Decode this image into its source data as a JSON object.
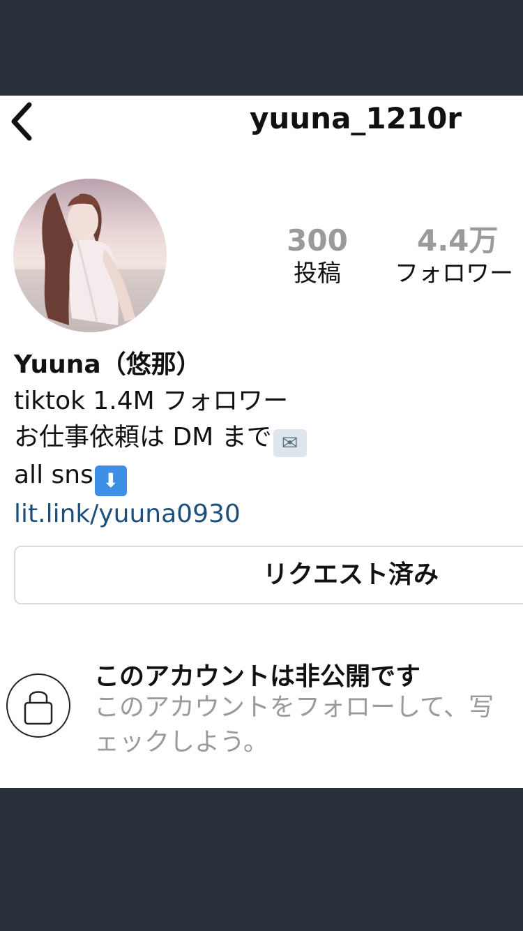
{
  "header": {
    "username": "yuuna_1210r"
  },
  "stats": {
    "posts_value": "300",
    "posts_label": "投稿",
    "followers_value": "4.4万",
    "followers_label": "フォロワー"
  },
  "bio": {
    "name": "Yuuna（悠那）",
    "line1": "tiktok 1.4M フォロワー",
    "line2": "お仕事依頼は DM まで",
    "line3": "all sns",
    "link": "lit.link/yuuna0930"
  },
  "actions": {
    "request_label": "リクエスト済み"
  },
  "private_notice": {
    "title": "このアカウントは非公開です",
    "desc_line1": "このアカウントをフォローして、写",
    "desc_line2": "ェックしよう。"
  },
  "icons": {
    "back": "chevron-left-icon",
    "lock": "lock-icon",
    "mail_emoji": "envelope-icon",
    "down_emoji": "down-arrow-icon"
  },
  "colors": {
    "background_dark": "#2a313c",
    "link": "#1d4e7a",
    "muted": "#9a9a9a"
  }
}
